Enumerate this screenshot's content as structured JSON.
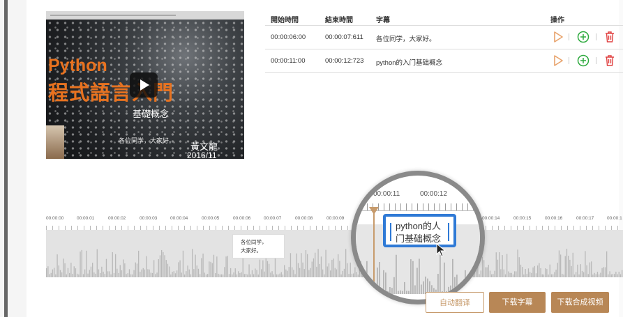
{
  "video": {
    "title_line1": "Python",
    "title_line2": "程式語言入門",
    "subtitle": "基礎概念",
    "caption": "各位同学，大家好。",
    "author": "黃文龍",
    "date": "2016/11"
  },
  "table": {
    "headers": {
      "start": "開始時間",
      "end": "結束時間",
      "subtitle": "字幕",
      "ops": "操作"
    },
    "rows": [
      {
        "start": "00:00:06:00",
        "end": "00:00:07:611",
        "subtitle": "各位同学，大家好。"
      },
      {
        "start": "00:00:11:00",
        "end": "00:00:12:723",
        "subtitle": "python的入门基础概念"
      }
    ],
    "icons": {
      "play": "play-outline-icon",
      "add": "plus-circle-icon",
      "delete": "trash-icon"
    },
    "colors": {
      "play": "#e8a26a",
      "add": "#2eaa3f",
      "delete": "#e04040"
    }
  },
  "timeline": {
    "ticks": [
      "00:00:00",
      "00:00:01",
      "00:00:02",
      "00:00:03",
      "00:00:04",
      "00:00:05",
      "00:00:06",
      "00:00:07",
      "00:00:08",
      "00:00:09",
      "00:00:14",
      "00:00:15",
      "00:00:16",
      "00:00:17",
      "00:00:1"
    ],
    "segment_line1": "各位同学，",
    "segment_line2": "大家好。"
  },
  "magnifier": {
    "tick_left": "00:00:11",
    "tick_right": "00:00:12",
    "segment_line1": "python的人",
    "segment_line2": "门基础概念"
  },
  "buttons": {
    "auto_translate": "自动翻译",
    "download_subtitles": "下载字幕",
    "download_merged_video": "下载合成视频"
  },
  "colors": {
    "accent": "#b88756",
    "selection": "#2f7ad6"
  }
}
